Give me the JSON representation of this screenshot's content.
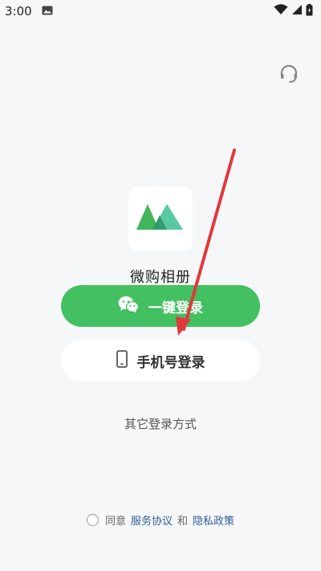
{
  "status_bar": {
    "time": "3:00",
    "icons": [
      "image-notification-icon",
      "wifi-icon",
      "signal-icon",
      "battery-icon"
    ]
  },
  "header": {
    "icon": "headset-support-icon"
  },
  "app": {
    "name": "微购相册",
    "logo_icon": "mountain-logo-icon"
  },
  "buttons": {
    "one_click_login": "一键登录",
    "one_click_login_icon": "wechat-icon",
    "phone_login": "手机号登录",
    "phone_login_icon": "phone-icon"
  },
  "other_login": "其它登录方式",
  "agreement": {
    "prefix": "同意",
    "service_link": "服务协议",
    "and": "和",
    "privacy_link": "隐私政策"
  },
  "colors": {
    "primary_green": "#43c061",
    "background": "#f6f7f9",
    "link": "#2f5f95",
    "annotation_arrow": "#e0393b"
  }
}
